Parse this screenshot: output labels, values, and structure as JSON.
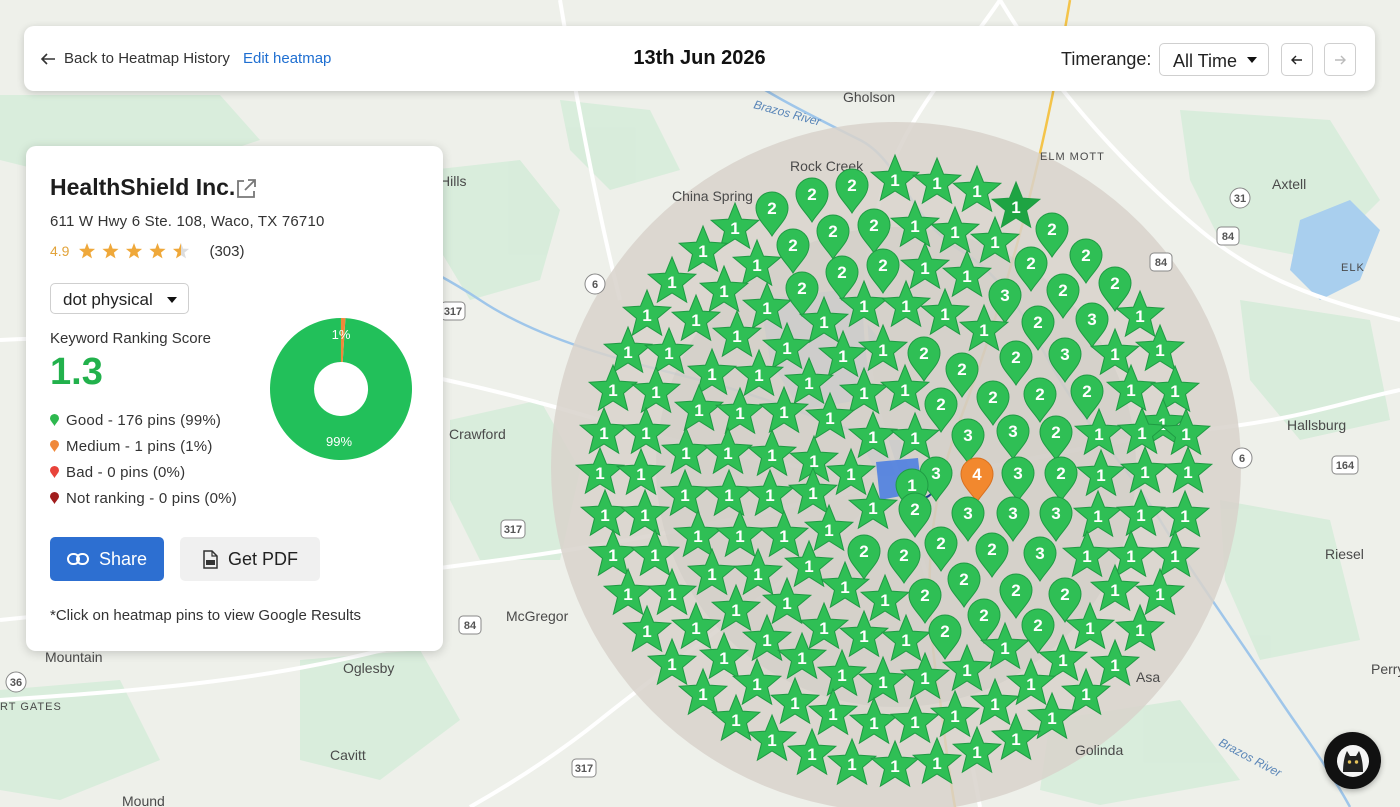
{
  "header": {
    "back_label": "Back to Heatmap History",
    "edit_label": "Edit heatmap",
    "date": "13th Jun 2026",
    "timerange_label": "Timerange:",
    "timerange_value": "All Time"
  },
  "business": {
    "name": "HealthShield Inc.",
    "address": "611 W Hwy 6 Ste. 108, Waco, TX 76710",
    "rating": "4.9",
    "stars_filled": 4.5,
    "review_count": "(303)"
  },
  "keyword": {
    "selected": "dot physical"
  },
  "score": {
    "label": "Keyword Ranking Score",
    "value": "1.3"
  },
  "legend": [
    {
      "key": "good",
      "text": "Good - 176 pins (99%)",
      "color": "#2eb84f"
    },
    {
      "key": "medium",
      "text": "Medium - 1 pins (1%)",
      "color": "#f0883a"
    },
    {
      "key": "bad",
      "text": "Bad - 0 pins (0%)",
      "color": "#e8433a"
    },
    {
      "key": "notranking",
      "text": "Not ranking - 0 pins (0%)",
      "color": "#a11d1d"
    }
  ],
  "donut": {
    "good_pct": 99,
    "medium_pct": 1,
    "good_label": "99%",
    "medium_label": "1%",
    "good_color": "#22c05a",
    "medium_color": "#f0883a"
  },
  "actions": {
    "share_label": "Share",
    "pdf_label": "Get PDF"
  },
  "note": "*Click on heatmap pins to view Google Results",
  "map": {
    "place_labels": [
      "Gholson",
      "Rock Creek",
      "China Spring",
      "Crawford",
      "McGregor",
      "Mountain",
      "Oglesby",
      "Cavitt",
      "Mound",
      "Axtell",
      "ELM MOTT",
      "ELK",
      "Hallsburg",
      "Riesel",
      "Asa",
      "Golinda",
      "Perry",
      "RT GATES",
      "Hills",
      "Brazos River",
      "Brazos River"
    ],
    "road_labels": [
      "6",
      "317",
      "84",
      "36",
      "317",
      "84",
      "317",
      "31",
      "84",
      "164",
      "6"
    ],
    "pin_colors": {
      "good": "#2fbf55",
      "medium": "#f2882e",
      "dark": "#1ea443"
    }
  }
}
